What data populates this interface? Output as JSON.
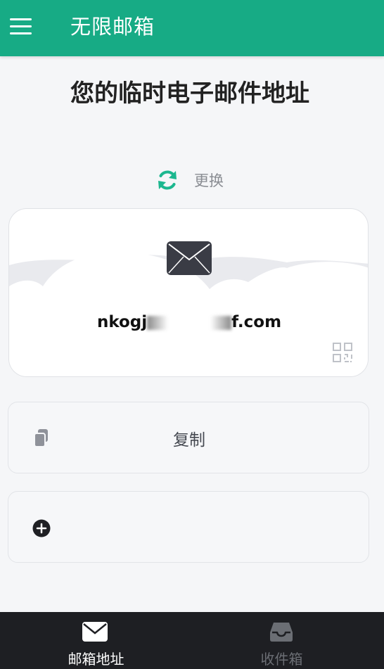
{
  "app_bar": {
    "title": "无限邮箱",
    "menu_icon": "hamburger-menu-icon",
    "color": "#17ab85"
  },
  "main": {
    "heading": "您的临时电子邮件地址",
    "refresh_label": "更换",
    "refresh_icon": "refresh-icon",
    "accent": "#1cb78f"
  },
  "email_card": {
    "icon": "envelope-icon",
    "address_visible_start": "nkogj",
    "address_visible_end": "f.com",
    "qr_icon": "qr-code-icon"
  },
  "actions": {
    "copy_label": "复制",
    "copy_icon": "copy-icon",
    "add_icon": "plus-circle-icon"
  },
  "bottom_nav": {
    "items": [
      {
        "label": "邮箱地址",
        "icon": "envelope-icon",
        "active": true
      },
      {
        "label": "收件箱",
        "icon": "inbox-icon",
        "active": false
      }
    ]
  }
}
